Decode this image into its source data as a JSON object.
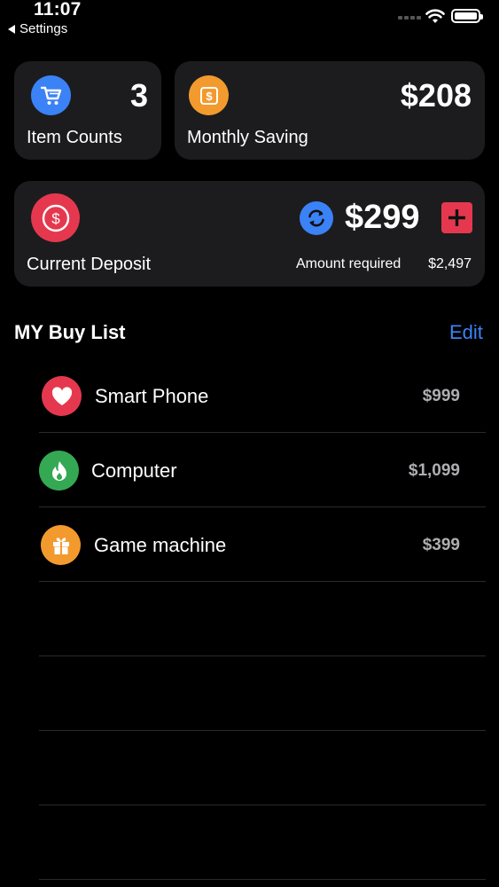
{
  "status_bar": {
    "time": "11:07",
    "back_label": "Settings"
  },
  "summary": {
    "item_counts": {
      "value": "3",
      "label": "Item Counts"
    },
    "monthly_saving": {
      "value": "$208",
      "label": "Monthly Saving"
    },
    "current_deposit": {
      "value": "$299",
      "label": "Current Deposit",
      "amount_required_label": "Amount required",
      "amount_required_value": "$2,497"
    }
  },
  "buy_list": {
    "title": "MY Buy List",
    "edit_label": "Edit",
    "items": [
      {
        "name": "Smart Phone",
        "price": "$999",
        "icon": "heart-icon",
        "color": "#e5384f"
      },
      {
        "name": "Computer",
        "price": "$1,099",
        "icon": "flame-icon",
        "color": "#34a853"
      },
      {
        "name": "Game machine",
        "price": "$399",
        "icon": "gift-icon",
        "color": "#f29a2e"
      }
    ]
  },
  "colors": {
    "background": "#000000",
    "card": "#1c1c1e",
    "accent_blue": "#3b82f6",
    "accent_red": "#e5384f",
    "accent_orange": "#f29a2e",
    "accent_green": "#34a853"
  }
}
